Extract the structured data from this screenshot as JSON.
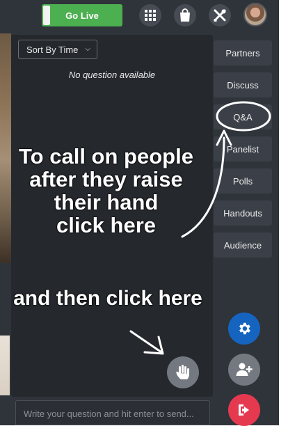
{
  "topbar": {
    "go_live_label": "Go Live",
    "icons": [
      "grid-icon",
      "shopping-bag-icon",
      "tools-icon"
    ],
    "avatar": "user-avatar"
  },
  "qa": {
    "sort_label": "Sort By Time",
    "empty_text": "No question available",
    "input_placeholder": "Write your question and hit enter to send..."
  },
  "sidebar": {
    "items": [
      {
        "label": "Partners"
      },
      {
        "label": "Discuss"
      },
      {
        "label": "Q&A"
      },
      {
        "label": "Panelist"
      },
      {
        "label": "Polls"
      },
      {
        "label": "Handouts"
      },
      {
        "label": "Audience"
      }
    ]
  },
  "annotations": {
    "line1": "To call on people",
    "line2": "after they raise",
    "line3": "their hand",
    "line4": "click here",
    "line5": "and then click here"
  },
  "colors": {
    "go_live": "#4caf50",
    "settings_button": "#1565c0",
    "add_user_button": "#747981",
    "leave_button": "#e53950"
  }
}
